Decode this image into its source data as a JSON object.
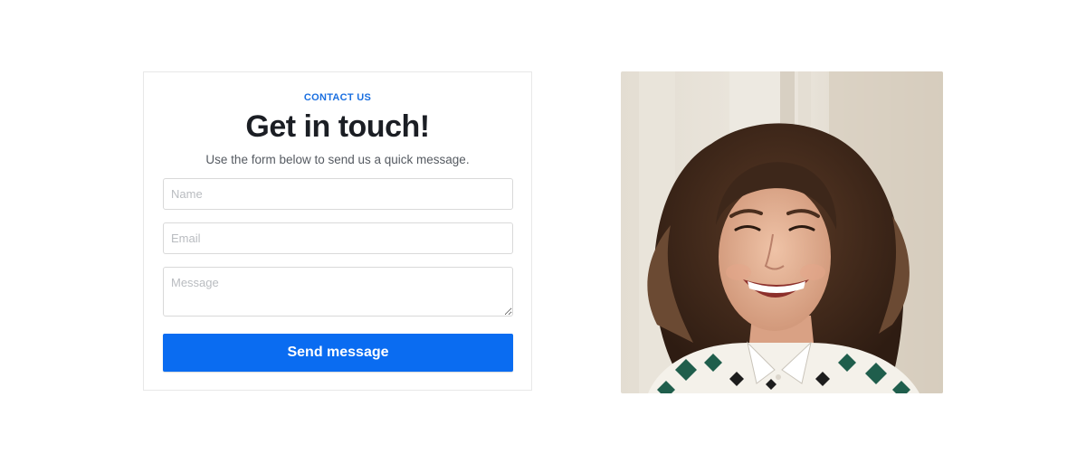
{
  "contact": {
    "eyebrow": "CONTACT US",
    "title": "Get in touch!",
    "subtitle": "Use the form below to send us a quick message.",
    "name_placeholder": "Name",
    "email_placeholder": "Email",
    "message_placeholder": "Message",
    "submit_label": "Send message"
  },
  "photo": {
    "subject": "smiling woman portrait"
  },
  "colors": {
    "accent": "#0a6cf1",
    "eyebrow": "#1a6fe0",
    "heading": "#1b1e24"
  }
}
